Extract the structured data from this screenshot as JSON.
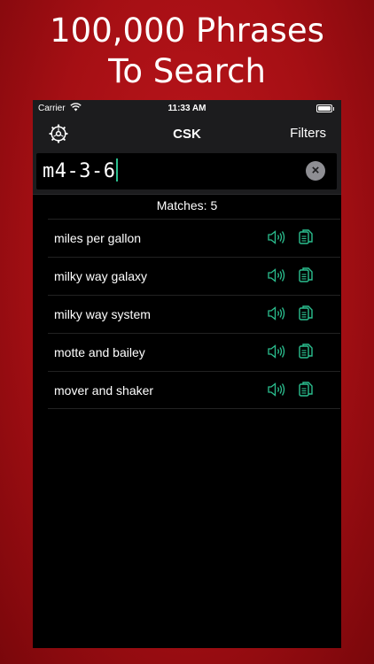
{
  "headline": {
    "line1": "100,000 Phrases",
    "line2": "To Search"
  },
  "status_bar": {
    "carrier": "Carrier",
    "time": "11:33 AM",
    "battery_level": 1.0
  },
  "nav": {
    "title": "CSK",
    "filters_label": "Filters",
    "settings_icon": "gear-icon"
  },
  "search": {
    "value": "m4-3-6",
    "clear_icon": "close-icon"
  },
  "matches_label": "Matches: 5",
  "results": [
    {
      "text": "miles per gallon"
    },
    {
      "text": "milky way galaxy"
    },
    {
      "text": "milky way system"
    },
    {
      "text": "motte and bailey"
    },
    {
      "text": "mover and shaker"
    }
  ],
  "row_icons": {
    "speak": "speaker-icon",
    "copy": "copy-icon"
  },
  "colors": {
    "accent": "#2bbf8f",
    "background_red": "#b01218",
    "surface": "#1c1c1e"
  }
}
